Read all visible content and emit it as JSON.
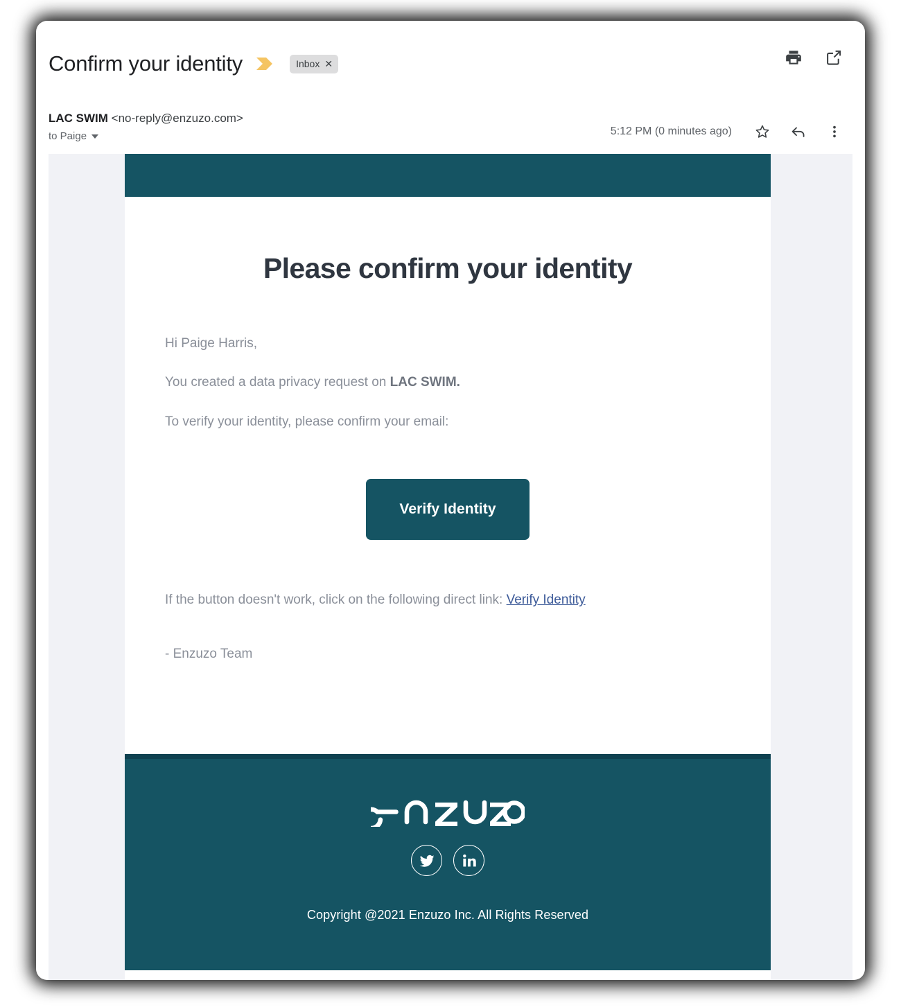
{
  "window": {
    "subject": "Confirm your identity",
    "important_marker_icon": "important-chevron-icon",
    "label_chip": {
      "text": "Inbox",
      "remove_icon": "close-x-icon"
    },
    "header_actions": [
      {
        "name": "print-icon",
        "label": "Print"
      },
      {
        "name": "open-in-new-window-icon",
        "label": "Open in new window"
      }
    ]
  },
  "message": {
    "sender_name": "LAC SWIM",
    "sender_email": "<no-reply@enzuzo.com>",
    "recipient": "to Paige",
    "recipient_caret_icon": "chevron-down-icon",
    "timestamp": "5:12 PM (0 minutes ago)",
    "actions": [
      {
        "name": "star-icon",
        "label": "Star"
      },
      {
        "name": "reply-icon",
        "label": "Reply"
      },
      {
        "name": "more-options-icon",
        "label": "More"
      }
    ]
  },
  "email": {
    "heading": "Please confirm your identity",
    "greeting": "Hi Paige Harris,",
    "line2_prefix": "You created a data privacy request on ",
    "line2_brand": "LAC SWIM.",
    "line3": "To verify your identity, please confirm your email:",
    "cta_label": "Verify Identity",
    "fallback_prefix": "If the button doesn't work, click on the following direct link: ",
    "fallback_link": "Verify Identity",
    "signoff": "- Enzuzo Team"
  },
  "footer": {
    "logo_text": "enzuzo",
    "social": [
      {
        "name": "twitter-icon",
        "label": "Twitter"
      },
      {
        "name": "linkedin-icon",
        "label": "LinkedIn"
      }
    ],
    "copyright": "Copyright @2021 Enzuzo Inc. All Rights Reserved"
  },
  "colors": {
    "brand_teal": "#155463",
    "brand_teal_dark": "#0f4150",
    "body_text": "#8a8f99",
    "link": "#3b5998",
    "heading": "#2f3640",
    "gutter": "#f1f2f6",
    "important_yellow": "#f5c462"
  }
}
